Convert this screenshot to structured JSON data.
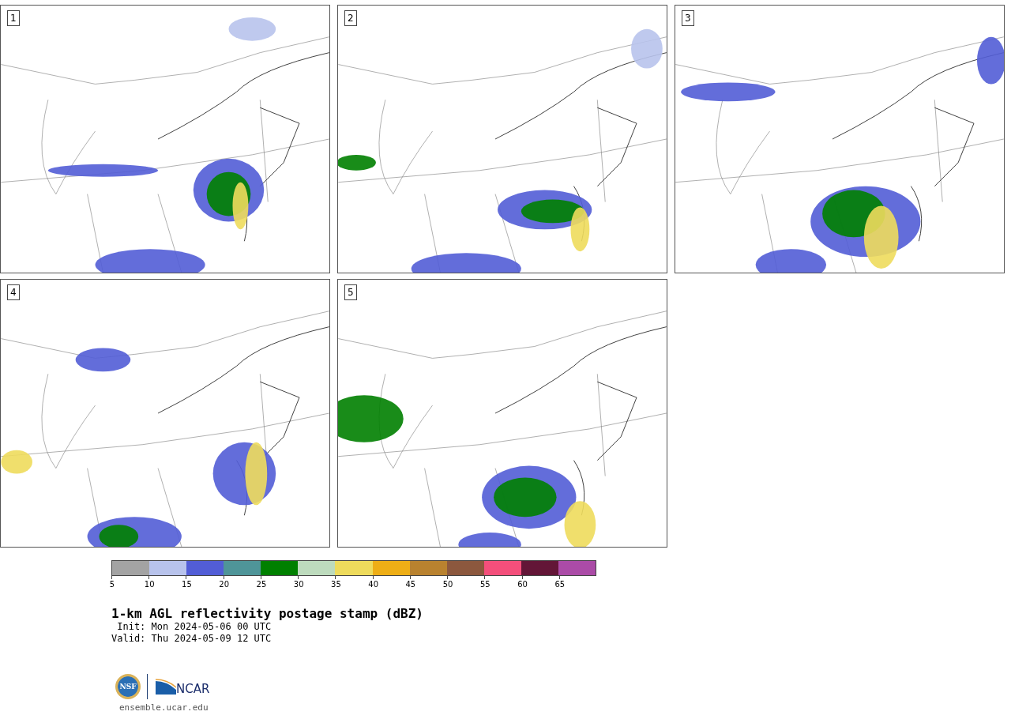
{
  "panels": [
    {
      "label": "1"
    },
    {
      "label": "2"
    },
    {
      "label": "3"
    },
    {
      "label": "4"
    },
    {
      "label": "5"
    }
  ],
  "colorbar": {
    "segments": [
      {
        "color": "#a3a3a3"
      },
      {
        "color": "#b8c3ec"
      },
      {
        "color": "#525dd6"
      },
      {
        "color": "#4f9599"
      },
      {
        "color": "#008000"
      },
      {
        "color": "#bddbbd"
      },
      {
        "color": "#eedb5c"
      },
      {
        "color": "#eeae16"
      },
      {
        "color": "#b9822f"
      },
      {
        "color": "#8c583e"
      },
      {
        "color": "#f44f7b"
      },
      {
        "color": "#631637"
      },
      {
        "color": "#ab4ba7"
      }
    ],
    "ticks": [
      "5",
      "10",
      "15",
      "20",
      "25",
      "30",
      "35",
      "40",
      "45",
      "50",
      "55",
      "60",
      "65"
    ]
  },
  "title": "1-km AGL reflectivity postage stamp (dBZ)",
  "init": " Init: Mon 2024-05-06 00 UTC",
  "valid": "Valid: Thu 2024-05-09 12 UTC",
  "logo": {
    "nsf": "NSF",
    "ncar": "NCAR"
  },
  "footer": "ensemble.ucar.edu"
}
